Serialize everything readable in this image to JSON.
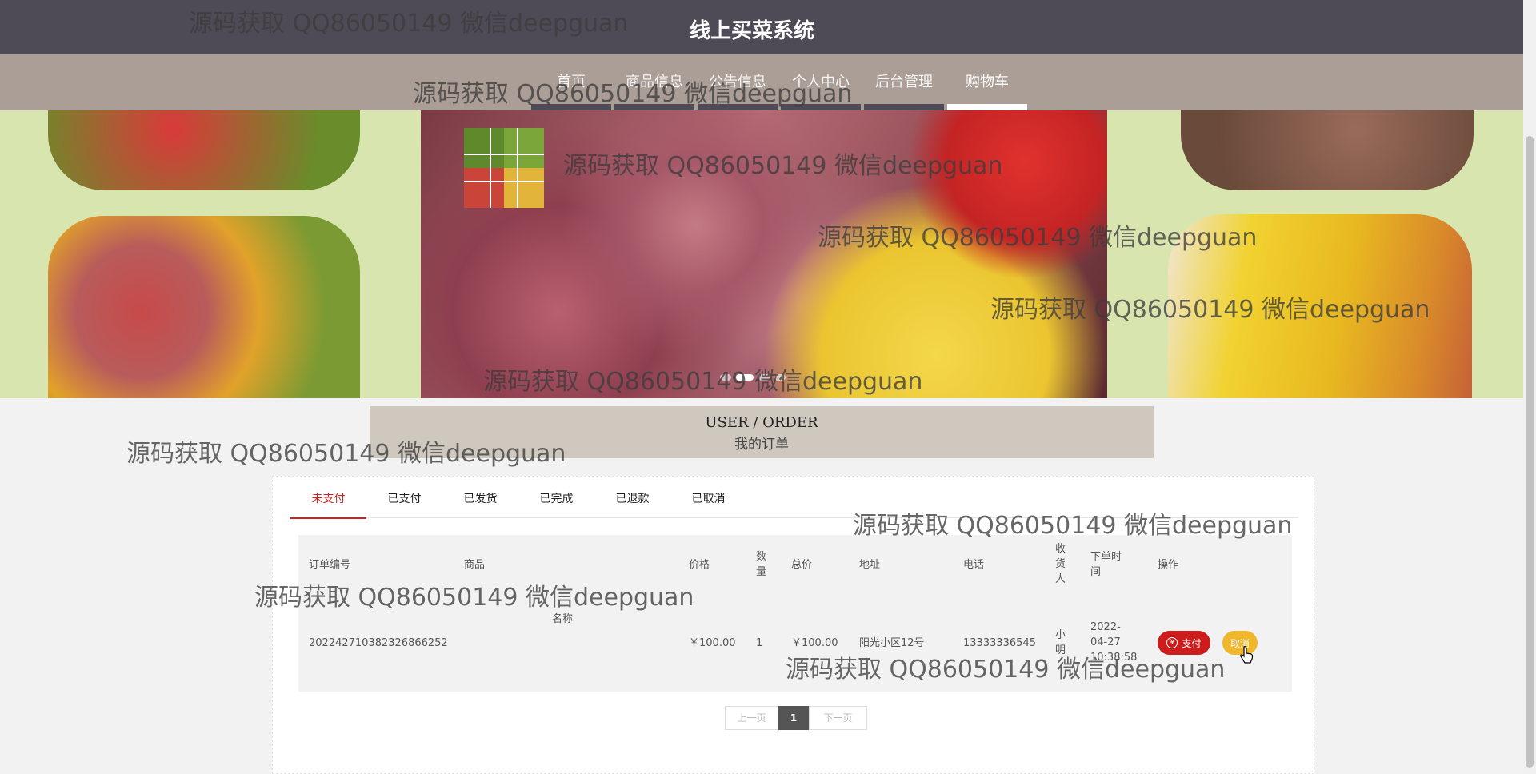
{
  "header": {
    "title": "线上买菜系统"
  },
  "nav": {
    "items": [
      {
        "label": "首页"
      },
      {
        "label": "商品信息"
      },
      {
        "label": "公告信息"
      },
      {
        "label": "个人中心"
      },
      {
        "label": "后台管理"
      },
      {
        "label": "购物车"
      }
    ],
    "active": "购物车"
  },
  "section": {
    "title_en": "USER / ORDER",
    "title_cn": "我的订单"
  },
  "tabs": {
    "items": [
      {
        "label": "未支付"
      },
      {
        "label": "已支付"
      },
      {
        "label": "已发货"
      },
      {
        "label": "已完成"
      },
      {
        "label": "已退款"
      },
      {
        "label": "已取消"
      }
    ],
    "active": "未支付"
  },
  "table": {
    "headers": {
      "order_no": "订单编号",
      "product": "商品",
      "price": "价格",
      "qty": "数\n量",
      "total": "总价",
      "address": "地址",
      "phone": "电话",
      "receiver": "收\n货\n人",
      "order_time": "下单时\n间",
      "actions": "操作"
    },
    "rows": [
      {
        "order_no": "20224271038232686625​2",
        "product_name": "名称",
        "price": "￥100.00",
        "qty": "1",
        "total": "￥100.00",
        "address": "阳光小区12号",
        "phone": "13333336545",
        "receiver": "小\n明",
        "order_time": "2022-\n04-27\n10:38:58",
        "pay_label": "支付",
        "cancel_label": "取消"
      }
    ]
  },
  "pagination": {
    "prev": "上一页",
    "current": "1",
    "next": "下一页"
  },
  "watermark": "源码获取 QQ86050149 微信deepguan",
  "colors": {
    "header_bg": "#4e4a56",
    "nav_bg": "#ab9e97",
    "accent_red": "#cc1c1c",
    "cancel_yellow": "#f0b72a"
  }
}
